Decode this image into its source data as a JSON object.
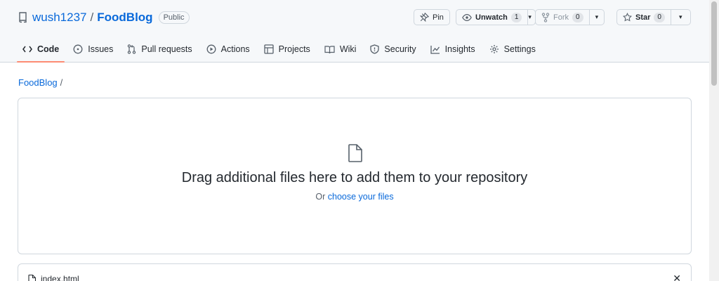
{
  "repo": {
    "owner": "wush1237",
    "name": "FoodBlog",
    "visibility": "Public"
  },
  "actions": {
    "pin": "Pin",
    "unwatch": "Unwatch",
    "watch_count": "1",
    "fork": "Fork",
    "fork_count": "0",
    "star": "Star",
    "star_count": "0"
  },
  "tabs": [
    {
      "label": "Code",
      "icon": "code-icon",
      "active": true
    },
    {
      "label": "Issues",
      "icon": "issue-icon"
    },
    {
      "label": "Pull requests",
      "icon": "pull-request-icon"
    },
    {
      "label": "Actions",
      "icon": "play-icon"
    },
    {
      "label": "Projects",
      "icon": "table-icon"
    },
    {
      "label": "Wiki",
      "icon": "book-icon"
    },
    {
      "label": "Security",
      "icon": "shield-icon"
    },
    {
      "label": "Insights",
      "icon": "graph-icon"
    },
    {
      "label": "Settings",
      "icon": "gear-icon"
    }
  ],
  "breadcrumb": {
    "repo": "FoodBlog",
    "separator": "/"
  },
  "dropzone": {
    "headline": "Drag additional files here to add them to your repository",
    "prefix": "Or",
    "link": "choose your files"
  },
  "files": [
    {
      "name": "index.html"
    }
  ],
  "colors": {
    "link": "#0969da",
    "active_tab_underline": "#fd8c73",
    "border": "#d0d7de",
    "header_bg": "#f6f8fa"
  }
}
